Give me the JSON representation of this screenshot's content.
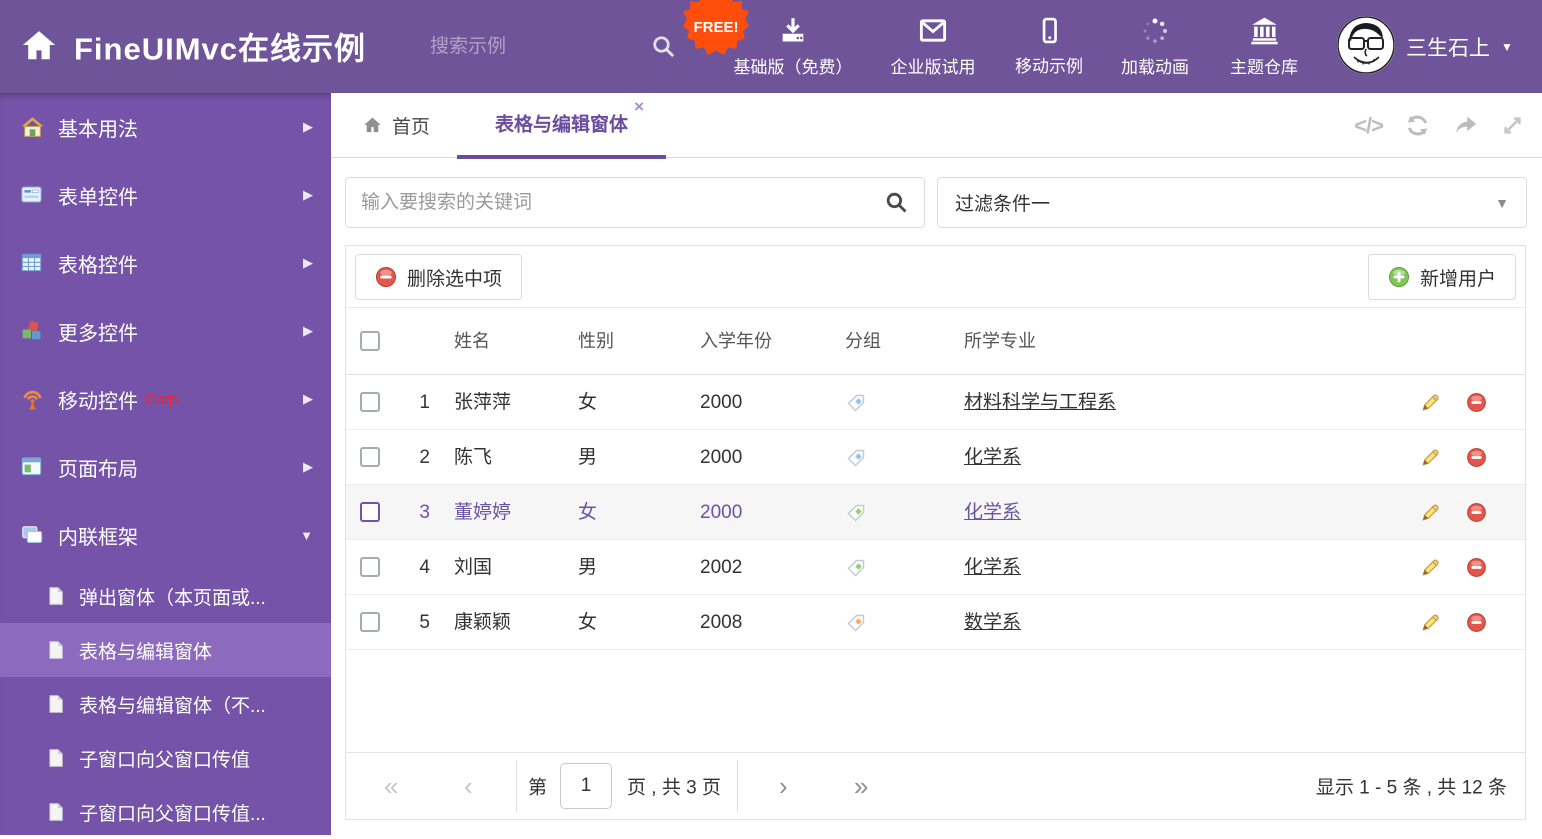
{
  "header": {
    "title": "FineUIMvc在线示例",
    "search_placeholder": "搜索示例",
    "free_badge": "FREE!",
    "nav": [
      {
        "label": "基础版（免费）",
        "icon": "download"
      },
      {
        "label": "企业版试用",
        "icon": "envelope"
      },
      {
        "label": "移动示例",
        "icon": "mobile"
      },
      {
        "label": "加载动画",
        "icon": "spinner"
      },
      {
        "label": "主题仓库",
        "icon": "bank"
      }
    ],
    "user": {
      "name": "三生石上"
    }
  },
  "sidebar": {
    "items": [
      {
        "label": "基本用法",
        "icon": "home-colored"
      },
      {
        "label": "表单控件",
        "icon": "form"
      },
      {
        "label": "表格控件",
        "icon": "table-grid"
      },
      {
        "label": "更多控件",
        "icon": "cubes"
      },
      {
        "label": "移动控件",
        "icon": "antenna",
        "badge": "Corp."
      },
      {
        "label": "页面布局",
        "icon": "layout"
      },
      {
        "label": "内联框架",
        "icon": "frames",
        "expanded": true
      }
    ],
    "subitems": [
      {
        "label": "弹出窗体（本页面或..."
      },
      {
        "label": "表格与编辑窗体",
        "selected": true
      },
      {
        "label": "表格与编辑窗体（不..."
      },
      {
        "label": "子窗口向父窗口传值"
      },
      {
        "label": "子窗口向父窗口传值..."
      }
    ]
  },
  "tabs": [
    {
      "label": "首页",
      "active": false
    },
    {
      "label": "表格与编辑窗体",
      "active": true
    }
  ],
  "filters": {
    "search_placeholder": "输入要搜索的关键词",
    "dropdown_value": "过滤条件一"
  },
  "toolbar": {
    "delete_label": "删除选中项",
    "add_label": "新增用户"
  },
  "table": {
    "columns": [
      "姓名",
      "性别",
      "入学年份",
      "分组",
      "所学专业"
    ],
    "rows": [
      {
        "index": "1",
        "name": "张萍萍",
        "gender": "女",
        "year": "2000",
        "tag_color": "#8AC6F2",
        "major": "材料科学与工程系",
        "selected": false
      },
      {
        "index": "2",
        "name": "陈飞",
        "gender": "男",
        "year": "2000",
        "tag_color": "#8AC6F2",
        "major": "化学系",
        "selected": false
      },
      {
        "index": "3",
        "name": "董婷婷",
        "gender": "女",
        "year": "2000",
        "tag_color": "#97CE6E",
        "major": "化学系",
        "selected": true
      },
      {
        "index": "4",
        "name": "刘国",
        "gender": "男",
        "year": "2002",
        "tag_color": "#97CE6E",
        "major": "化学系",
        "selected": false
      },
      {
        "index": "5",
        "name": "康颖颖",
        "gender": "女",
        "year": "2008",
        "tag_color": "#F5AE63",
        "major": "数学系",
        "selected": false
      }
    ]
  },
  "pagination": {
    "prefix": "第",
    "page_value": "1",
    "suffix": "页 , 共 3 页",
    "summary": "显示 1 - 5 条 , 共 12 条"
  },
  "icons": {
    "arrow_right": "▶",
    "caret_down": "▼",
    "close": "×",
    "code_tag": "</>",
    "first_page": "«",
    "prev_page": "‹",
    "next_page": "›",
    "last_page": "»"
  },
  "colors": {
    "header_bg": "#6F5499",
    "sidebar_bg": "#7553A9",
    "sidebar_selected_bg": "#8C6BBE",
    "accent": "#6B4C9E",
    "free_badge_bg": "#FF4E0B",
    "corp_badge": "#FF1F1F",
    "delete_red": "#E4564C",
    "add_green": "#82C659",
    "tag_blue": "#8AC6F2",
    "tag_green": "#97CE6E",
    "tag_orange": "#F5AE63",
    "selected_row_bg": "#F6F6F6",
    "selected_row_text": "#6B52A3"
  }
}
